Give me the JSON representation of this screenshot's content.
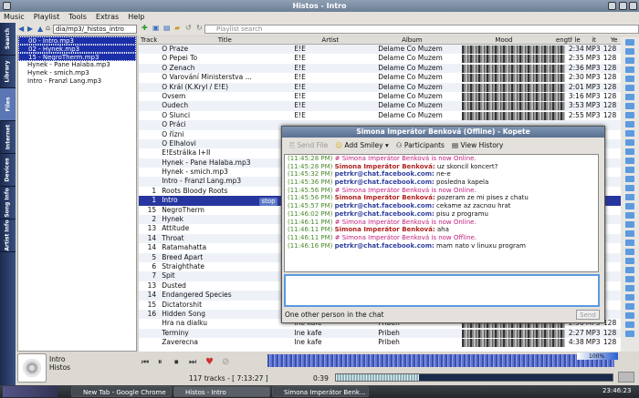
{
  "window": {
    "title": "Histos - Intro"
  },
  "menu": [
    "Music",
    "Playlist",
    "Tools",
    "Extras",
    "Help"
  ],
  "sidebar_tabs": [
    "Search",
    "Library",
    "Files",
    "Internet",
    "Devices",
    "Song Info",
    "Artist Info"
  ],
  "nav": {
    "path": "dia/mp3/_histos_intro"
  },
  "files": [
    {
      "name": "00 - Intro.mp3",
      "sel": true
    },
    {
      "name": "02 - Hynek.mp3",
      "sel": true
    },
    {
      "name": "15 - NegroTherm.mp3",
      "sel": true
    },
    {
      "name": "Hynek - Pane Halaba.mp3",
      "sel": false
    },
    {
      "name": "Hynek - smich.mp3",
      "sel": false
    },
    {
      "name": "Intro - Franzl Lang.mp3",
      "sel": false
    }
  ],
  "search": {
    "placeholder": "Playlist search"
  },
  "columns": {
    "track": "Track",
    "title": "Title",
    "artist": "Artist",
    "album": "Album",
    "mood": "Mood",
    "length": "ength",
    "type": "le typ",
    "bitrate": "it rate",
    "year": "Ye"
  },
  "rows": [
    {
      "track": "",
      "title": "O Praze",
      "artist": "E!E",
      "album": "Delame Co Muzem",
      "length": "2:34",
      "type": "MP3",
      "br": "128"
    },
    {
      "track": "",
      "title": "O Pepei To",
      "artist": "E!E",
      "album": "Delame Co Muzem",
      "length": "2:35",
      "type": "MP3",
      "br": "128"
    },
    {
      "track": "",
      "title": "O Zenach",
      "artist": "E!E",
      "album": "Delame Co Muzem",
      "length": "2:36",
      "type": "MP3",
      "br": "128"
    },
    {
      "track": "",
      "title": "O Varování Ministerstva ...",
      "artist": "E!E",
      "album": "Delame Co Muzem",
      "length": "2:30",
      "type": "MP3",
      "br": "128"
    },
    {
      "track": "",
      "title": "O Král (K.Kryl / E!E)",
      "artist": "E!E",
      "album": "Delame Co Muzem",
      "length": "2:01",
      "type": "MP3",
      "br": "128"
    },
    {
      "track": "",
      "title": "Ovsem",
      "artist": "E!E",
      "album": "Delame Co Muzem",
      "length": "3:16",
      "type": "MP3",
      "br": "128"
    },
    {
      "track": "",
      "title": "Oudech",
      "artist": "E!E",
      "album": "Delame Co Muzem",
      "length": "3:53",
      "type": "MP3",
      "br": "128"
    },
    {
      "track": "",
      "title": "O Slunci",
      "artist": "E!E",
      "album": "Delame Co Muzem",
      "length": "2:55",
      "type": "MP3",
      "br": "128"
    },
    {
      "track": "",
      "title": "O Práci",
      "artist": "",
      "album": "",
      "length": "",
      "type": "",
      "br": ""
    },
    {
      "track": "",
      "title": "O řízni",
      "artist": "",
      "album": "",
      "length": "",
      "type": "",
      "br": ""
    },
    {
      "track": "",
      "title": "O Elhalovi",
      "artist": "",
      "album": "",
      "length": "",
      "type": "",
      "br": ""
    },
    {
      "track": "",
      "title": "E!Estrálka I+II",
      "artist": "",
      "album": "",
      "length": "",
      "type": "",
      "br": ""
    },
    {
      "track": "",
      "title": "Hynek - Pane Halaba.mp3",
      "artist": "",
      "album": "",
      "length": "",
      "type": "",
      "br": ""
    },
    {
      "track": "",
      "title": "Hynek - smich.mp3",
      "artist": "",
      "album": "",
      "length": "",
      "type": "",
      "br": ""
    },
    {
      "track": "",
      "title": "Intro - Franzl Lang.mp3",
      "artist": "",
      "album": "",
      "length": "",
      "type": "",
      "br": ""
    },
    {
      "track": "1",
      "title": "Roots Bloody Roots",
      "artist": "",
      "album": "",
      "length": "",
      "type": "",
      "br": ""
    },
    {
      "track": "1",
      "title": "Intro",
      "artist": "",
      "album": "",
      "length": "",
      "type": "",
      "br": "",
      "cur": true
    },
    {
      "track": "15",
      "title": "NegroTherm",
      "artist": "",
      "album": "",
      "length": "",
      "type": "",
      "br": ""
    },
    {
      "track": "2",
      "title": "Hynek",
      "artist": "",
      "album": "",
      "length": "",
      "type": "",
      "br": ""
    },
    {
      "track": "13",
      "title": "Attitude",
      "artist": "",
      "album": "",
      "length": "",
      "type": "",
      "br": ""
    },
    {
      "track": "14",
      "title": "Throat",
      "artist": "",
      "album": "",
      "length": "",
      "type": "",
      "br": ""
    },
    {
      "track": "14",
      "title": "Ratamahatta",
      "artist": "",
      "album": "",
      "length": "",
      "type": "",
      "br": ""
    },
    {
      "track": "5",
      "title": "Breed Apart",
      "artist": "",
      "album": "",
      "length": "",
      "type": "",
      "br": ""
    },
    {
      "track": "6",
      "title": "Straighthate",
      "artist": "",
      "album": "",
      "length": "",
      "type": "",
      "br": ""
    },
    {
      "track": "7",
      "title": "Spit",
      "artist": "",
      "album": "",
      "length": "",
      "type": "",
      "br": ""
    },
    {
      "track": "13",
      "title": "Dusted",
      "artist": "",
      "album": "",
      "length": "",
      "type": "",
      "br": ""
    },
    {
      "track": "14",
      "title": "Endangered Species",
      "artist": "",
      "album": "",
      "length": "",
      "type": "",
      "br": ""
    },
    {
      "track": "15",
      "title": "Dictatorshit",
      "artist": "",
      "album": "",
      "length": "",
      "type": "",
      "br": ""
    },
    {
      "track": "16",
      "title": "Hidden Song",
      "artist": "",
      "album": "",
      "length": "",
      "type": "",
      "br": ""
    },
    {
      "track": "",
      "title": "Hra na dialku",
      "artist": "Ine kafe",
      "album": "Pribeh",
      "length": "2:50",
      "type": "MP3",
      "br": "128"
    },
    {
      "track": "",
      "title": "Terminy",
      "artist": "Ine kafe",
      "album": "Pribeh",
      "length": "2:27",
      "type": "MP3",
      "br": "128"
    },
    {
      "track": "",
      "title": "Zaverecna",
      "artist": "Ine kafe",
      "album": "Pribeh",
      "length": "4:38",
      "type": "MP3",
      "br": "128"
    }
  ],
  "stop_badge": "stop",
  "now_playing": {
    "artist": "Intro",
    "album": "Histos"
  },
  "status": {
    "tracks": "117 tracks - [ 7:13:27 ]",
    "elapsed": "0:39",
    "volume": "100%"
  },
  "kopete": {
    "title": "Simona Imperátor Benková (Offline) - Kopete",
    "send_file": "Send File",
    "add_smiley": "Add Smiley",
    "participants": "Participants",
    "view_history": "View History",
    "messages": [
      {
        "t": "(11:45:28 PM)",
        "kind": "sys",
        "who": "",
        "text": "# Simona Imperátor Benková is now Online."
      },
      {
        "t": "(11:45:28 PM)",
        "kind": "a",
        "who": "Simona Imperátor Benková:",
        "text": "uz skoncil koncert?"
      },
      {
        "t": "(11:45:32 PM)",
        "kind": "b",
        "who": "petrkr@chat.facebook.com:",
        "text": "ne-e"
      },
      {
        "t": "(11:45:36 PM)",
        "kind": "b",
        "who": "petrkr@chat.facebook.com:",
        "text": "posledna kapela"
      },
      {
        "t": "(11:45:56 PM)",
        "kind": "sys",
        "who": "",
        "text": "# Simona Imperátor Benková is now Online."
      },
      {
        "t": "(11:45:56 PM)",
        "kind": "a",
        "who": "Simona Imperátor Benková:",
        "text": "pozeram ze mi pises z chatu"
      },
      {
        "t": "(11:45:57 PM)",
        "kind": "b",
        "who": "petrkr@chat.facebook.com:",
        "text": "cekame az zacnou hrat"
      },
      {
        "t": "(11:46:02 PM)",
        "kind": "b",
        "who": "petrkr@chat.facebook.com:",
        "text": "pisu z programu"
      },
      {
        "t": "(11:46:11 PM)",
        "kind": "sys",
        "who": "",
        "text": "# Simona Imperátor Benková is now Online."
      },
      {
        "t": "(11:46:11 PM)",
        "kind": "a",
        "who": "Simona Imperátor Benková:",
        "text": "aha"
      },
      {
        "t": "(11:46:11 PM)",
        "kind": "sys",
        "who": "",
        "text": "# Simona Imperátor Benková is now Offline."
      },
      {
        "t": "(11:46:16 PM)",
        "kind": "b",
        "who": "petrkr@chat.facebook.com:",
        "text": "mam nato v linuxu program"
      }
    ],
    "status": "One other person in the chat",
    "send": "Send"
  },
  "taskbar": {
    "tasks": [
      "New Tab - Google Chrome",
      "Histos - Intro",
      "Simona Imperátor Benk..."
    ],
    "clock": "23:46:23"
  }
}
